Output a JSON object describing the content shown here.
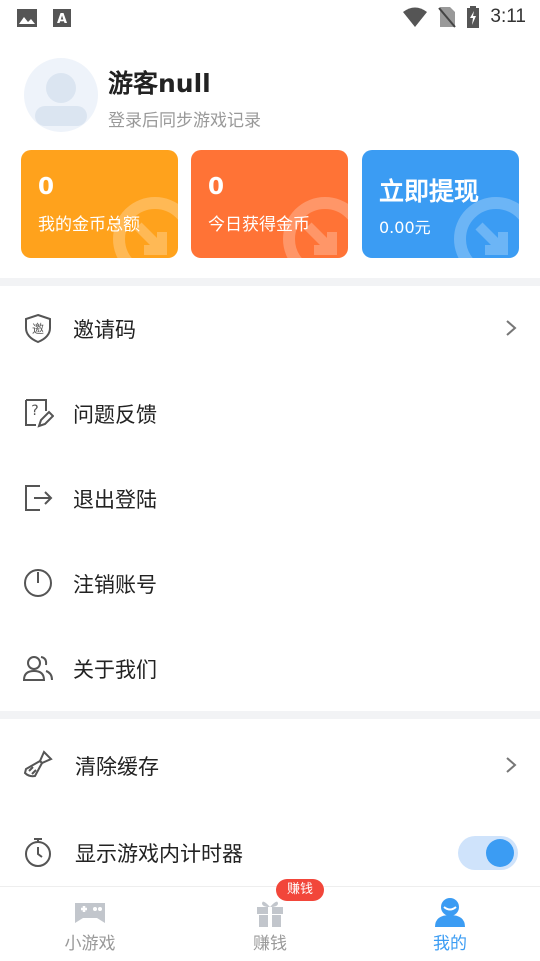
{
  "status_bar": {
    "time": "3:11"
  },
  "profile": {
    "username": "游客null",
    "subtitle": "登录后同步游戏记录"
  },
  "cards": {
    "coins_total": {
      "value": "0",
      "label": "我的金币总额",
      "color": "#ffa21c"
    },
    "today_coins": {
      "value": "0",
      "label": "今日获得金币",
      "color": "#ff7336"
    },
    "withdraw": {
      "title": "立即提现",
      "amount": "0.00元",
      "color": "#3b9cf3"
    }
  },
  "menu": {
    "invite_code": {
      "label": "邀请码",
      "icon": "invite-shield-icon"
    },
    "feedback": {
      "label": "问题反馈",
      "icon": "feedback-icon"
    },
    "logout": {
      "label": "退出登陆",
      "icon": "logout-icon"
    },
    "delete_account": {
      "label": "注销账号",
      "icon": "power-icon"
    },
    "about": {
      "label": "关于我们",
      "icon": "users-icon"
    },
    "clear_cache": {
      "label": "清除缓存",
      "icon": "brush-icon"
    },
    "show_timer": {
      "label": "显示游戏内计时器",
      "icon": "stopwatch-icon",
      "enabled": true
    }
  },
  "bottom_nav": {
    "items": [
      {
        "label": "小游戏",
        "icon": "gamepad-icon",
        "active": false
      },
      {
        "label": "赚钱",
        "icon": "gift-icon",
        "active": false
      },
      {
        "label": "我的",
        "icon": "profile-icon",
        "active": true
      }
    ],
    "earn_badge": "赚钱"
  },
  "accent_color": "#3b9cf3"
}
